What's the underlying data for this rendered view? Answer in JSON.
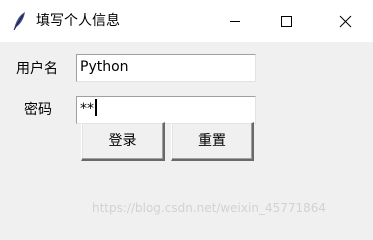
{
  "window": {
    "title": "填写个人信息",
    "icon": "feather-icon",
    "controls": {
      "minimize_icon": "minimize-icon",
      "maximize_icon": "maximize-icon",
      "close_icon": "close-icon"
    }
  },
  "form": {
    "username_label": "用户名",
    "username_value": "Python",
    "password_label": "密码",
    "password_value": "**"
  },
  "buttons": {
    "login_label": "登录",
    "reset_label": "重置"
  },
  "watermark": "https://blog.csdn.net/weixin_45771864"
}
